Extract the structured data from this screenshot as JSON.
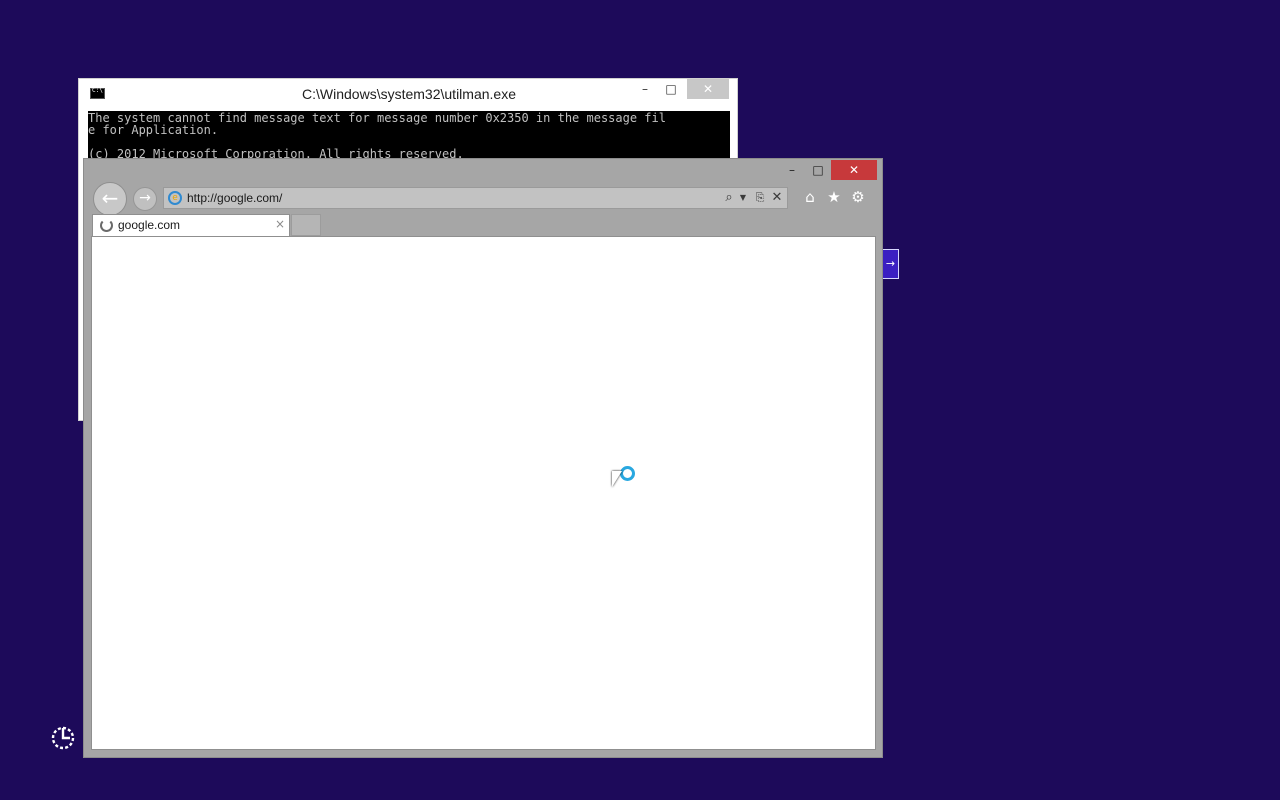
{
  "console_window": {
    "title": "C:\\Windows\\system32\\utilman.exe",
    "minimize_glyph": "–",
    "maximize_glyph": "□",
    "close_glyph": "✕",
    "output": "The system cannot find message text for message number 0x2350 in the message fil\ne for Application.\n\n(c) 2012 Microsoft Corporation. All rights reserved."
  },
  "browser_window": {
    "minimize_glyph": "–",
    "maximize_glyph": "□",
    "close_glyph": "✕",
    "address": "http://google.com/",
    "tab": {
      "title": "google.com",
      "close_glyph": "×"
    },
    "colors": {
      "frame": "#a6a6a6",
      "close_button": "#c7393b"
    }
  },
  "desktop": {
    "background_color": "#1d0a5a"
  }
}
